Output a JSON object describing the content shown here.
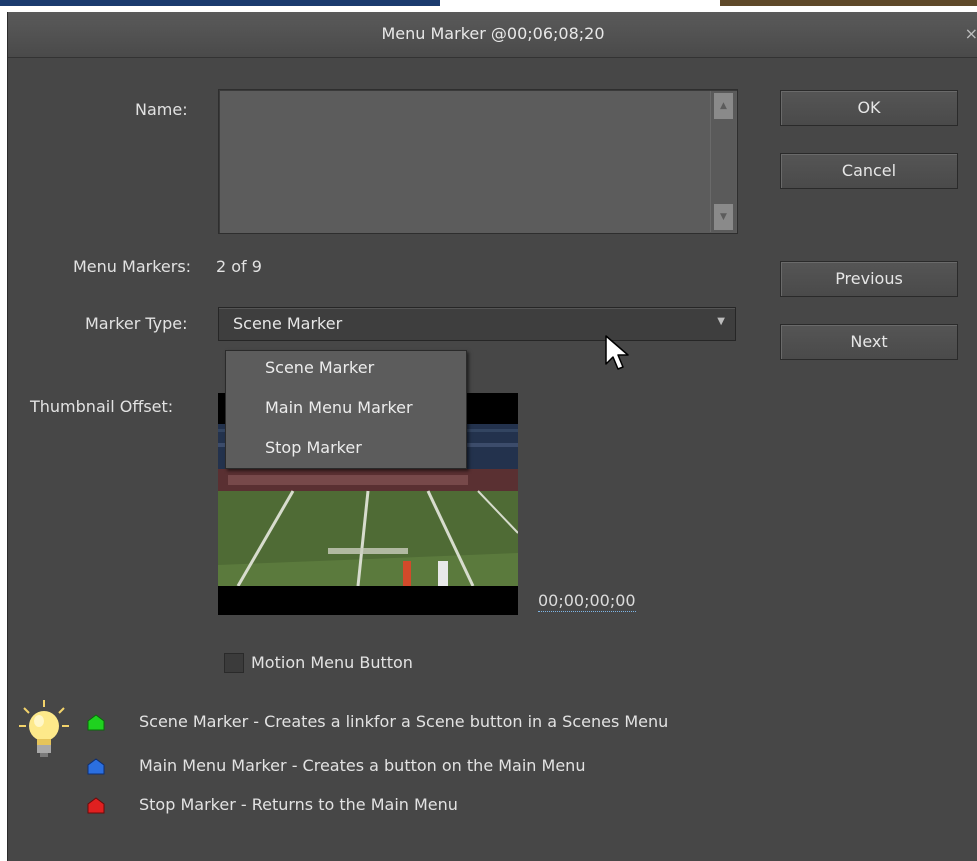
{
  "dialog": {
    "title": "Menu Marker @00;06;08;20",
    "close_glyph": "×"
  },
  "form": {
    "name_label": "Name:",
    "name_value": "",
    "menu_markers_label": "Menu Markers:",
    "menu_markers_value": "2 of 9",
    "marker_type_label": "Marker Type:",
    "marker_type_value": "Scene Marker",
    "thumbnail_offset_label": "Thumbnail Offset:",
    "thumbnail_timecode": "00;00;00;00",
    "motion_menu_label": "Motion Menu Button",
    "motion_menu_checked": false
  },
  "buttons": {
    "ok": "OK",
    "cancel": "Cancel",
    "previous": "Previous",
    "next": "Next"
  },
  "marker_type_options": [
    "Scene Marker",
    "Main Menu Marker",
    "Stop Marker"
  ],
  "legend": [
    {
      "icon": "green-marker-icon",
      "color": "#1fd21f",
      "text": "Scene Marker - Creates a linkfor a Scene button in a Scenes Menu"
    },
    {
      "icon": "blue-marker-icon",
      "color": "#2b6fe0",
      "text": "Main Menu Marker - Creates a button on the Main Menu"
    },
    {
      "icon": "red-marker-icon",
      "color": "#e02020",
      "text": "Stop Marker - Returns to the Main Menu"
    }
  ],
  "icons": {
    "tip": "lightbulb-icon",
    "cursor": "mouse-cursor-icon"
  },
  "colors": {
    "dialog_bg": "#474747",
    "titlebar": "#545454",
    "timecode_underline": "#7fb6e6"
  }
}
